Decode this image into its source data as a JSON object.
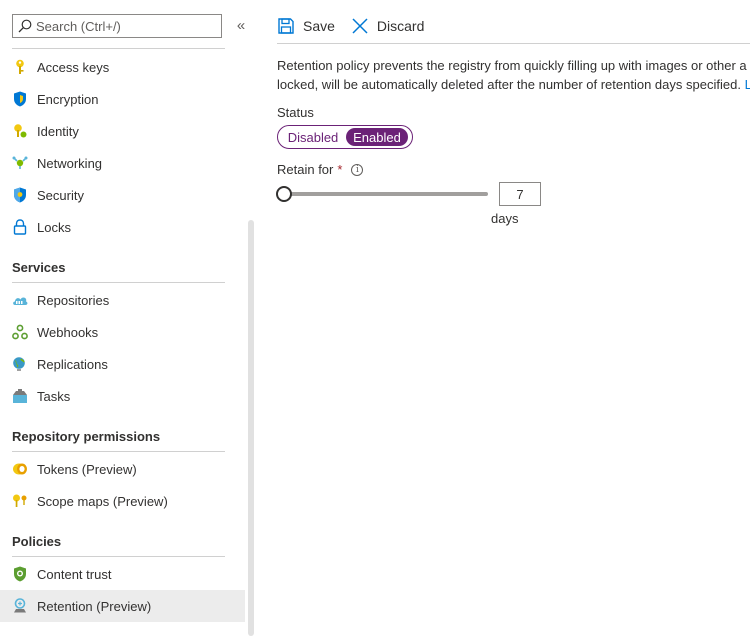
{
  "sidebar": {
    "search_placeholder": "Search (Ctrl+/)",
    "collapse_glyph": "«",
    "items_top": [
      {
        "label": "Access keys",
        "icon": "key-icon"
      },
      {
        "label": "Encryption",
        "icon": "shield-icon"
      },
      {
        "label": "Identity",
        "icon": "identity-icon"
      },
      {
        "label": "Networking",
        "icon": "networking-icon"
      },
      {
        "label": "Security",
        "icon": "security-icon"
      },
      {
        "label": "Locks",
        "icon": "lock-icon"
      }
    ],
    "sections": [
      {
        "title": "Services",
        "items": [
          {
            "label": "Repositories",
            "icon": "repositories-icon"
          },
          {
            "label": "Webhooks",
            "icon": "webhooks-icon"
          },
          {
            "label": "Replications",
            "icon": "globe-icon"
          },
          {
            "label": "Tasks",
            "icon": "tasks-icon"
          }
        ]
      },
      {
        "title": "Repository permissions",
        "items": [
          {
            "label": "Tokens (Preview)",
            "icon": "token-icon"
          },
          {
            "label": "Scope maps (Preview)",
            "icon": "scope-map-icon"
          }
        ]
      },
      {
        "title": "Policies",
        "items": [
          {
            "label": "Content trust",
            "icon": "content-trust-icon"
          },
          {
            "label": "Retention (Preview)",
            "icon": "retention-icon",
            "selected": true
          }
        ]
      }
    ]
  },
  "toolbar": {
    "save_label": "Save",
    "discard_label": "Discard"
  },
  "main": {
    "description_line1": "Retention policy prevents the registry from quickly filling up with images or other a",
    "description_line2": "locked, will be automatically deleted after the number of retention days specified.",
    "description_link": "L",
    "status_label": "Status",
    "status_options": [
      "Disabled",
      "Enabled"
    ],
    "status_selected": "Enabled",
    "retain_label": "Retain for",
    "required_marker": "*",
    "info_glyph": "i",
    "retain_days": "7",
    "retain_slider_fraction": 0.0,
    "days_unit": "days"
  },
  "colors": {
    "accent": "#6b2277",
    "link": "#0078d4",
    "selected_bg": "#ececec",
    "required": "#a4262c"
  }
}
